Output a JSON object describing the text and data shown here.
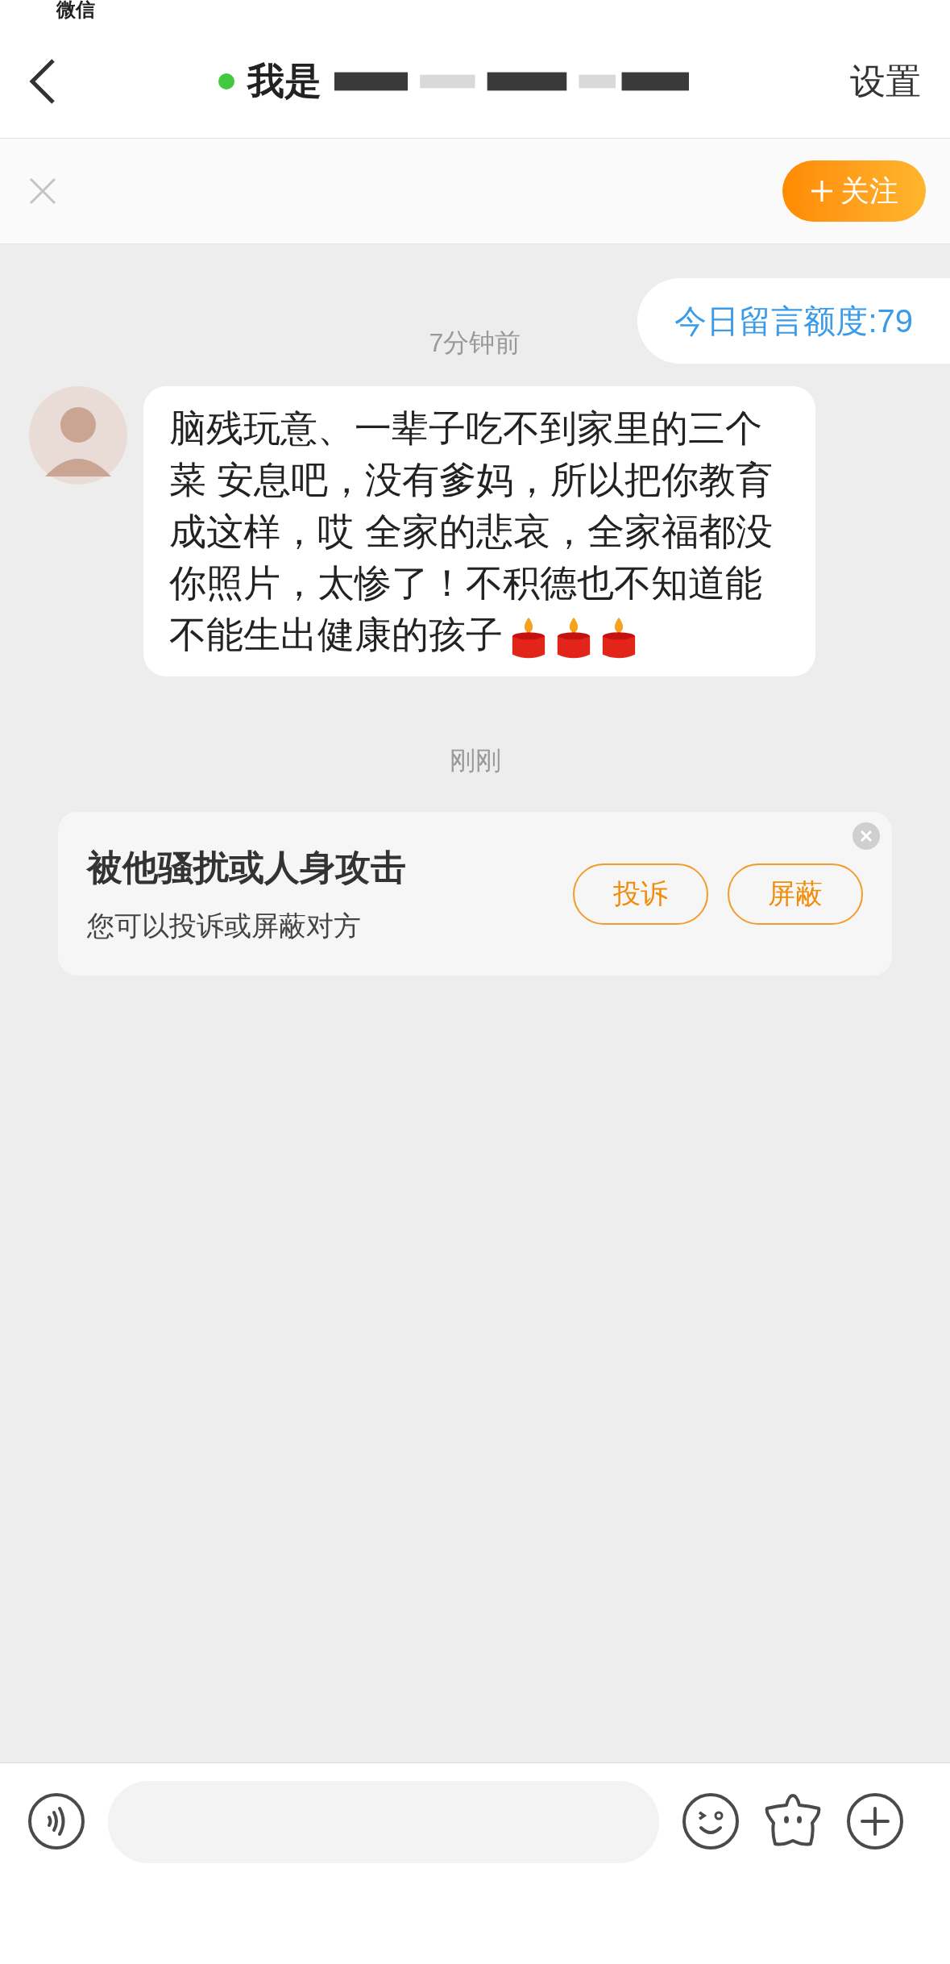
{
  "status_bar": {
    "back_label": "微信"
  },
  "nav": {
    "title": "我是",
    "online": true,
    "settings": "设置"
  },
  "follow_bar": {
    "follow_button": "关注"
  },
  "messages": [
    {
      "kind": "quota",
      "text": "今日留言额度:79"
    },
    {
      "kind": "time",
      "text": "7分钟前"
    },
    {
      "kind": "incoming",
      "text": "脑残玩意、一辈子吃不到家里的三个菜 安息吧，没有爹妈，所以把你教育成这样，哎 全家的悲哀，全家福都没你照片，太惨了！不积德也不知道能不能生出健康的孩子"
    },
    {
      "kind": "time",
      "text": "刚刚"
    },
    {
      "kind": "report_card",
      "title": "被他骚扰或人身攻击",
      "subtitle": "您可以投诉或屏蔽对方",
      "buttons": [
        "投诉",
        "屏蔽"
      ]
    }
  ]
}
